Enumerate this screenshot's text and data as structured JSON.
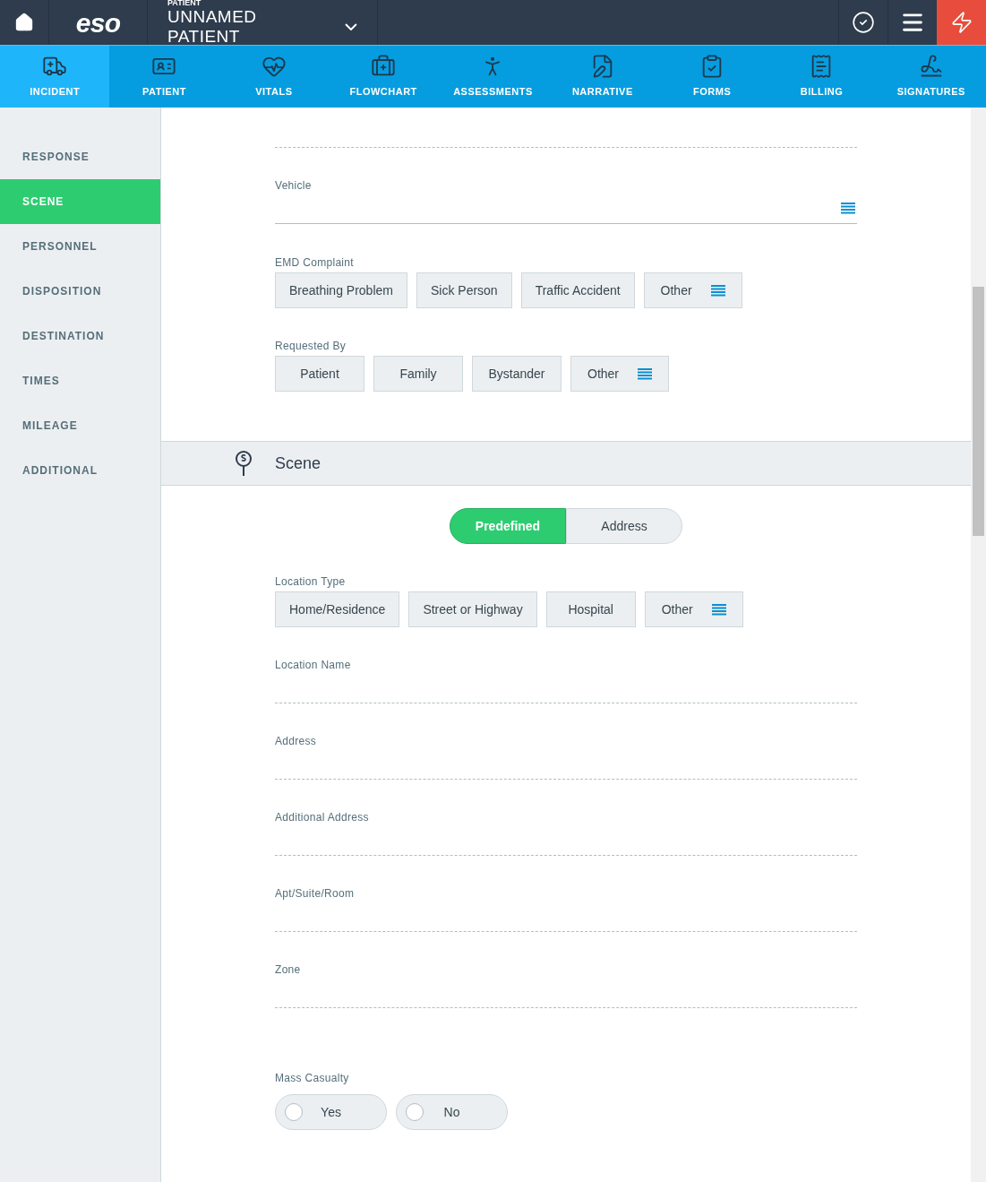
{
  "header": {
    "patient_label": "PATIENT",
    "patient_name": "UNNAMED PATIENT",
    "logo": "eso"
  },
  "nav_tabs": [
    {
      "label": "INCIDENT",
      "selected": true
    },
    {
      "label": "PATIENT",
      "selected": false
    },
    {
      "label": "VITALS",
      "selected": false
    },
    {
      "label": "FLOWCHART",
      "selected": false
    },
    {
      "label": "ASSESSMENTS",
      "selected": false
    },
    {
      "label": "NARRATIVE",
      "selected": false
    },
    {
      "label": "FORMS",
      "selected": false
    },
    {
      "label": "BILLING",
      "selected": false
    },
    {
      "label": "SIGNATURES",
      "selected": false
    }
  ],
  "sidebar": {
    "items": [
      {
        "label": "RESPONSE",
        "selected": false
      },
      {
        "label": "SCENE",
        "selected": true
      },
      {
        "label": "PERSONNEL",
        "selected": false
      },
      {
        "label": "DISPOSITION",
        "selected": false
      },
      {
        "label": "DESTINATION",
        "selected": false
      },
      {
        "label": "TIMES",
        "selected": false
      },
      {
        "label": "MILEAGE",
        "selected": false
      },
      {
        "label": "ADDITIONAL",
        "selected": false
      }
    ]
  },
  "response_fields": [
    {
      "kind": "select",
      "label": "Vehicle"
    },
    {
      "kind": "choices",
      "label": "EMD Complaint",
      "options": [
        {
          "label": "Breathing Problem",
          "selected": false
        },
        {
          "label": "Sick Person",
          "selected": false
        },
        {
          "label": "Traffic Accident",
          "selected": false
        }
      ],
      "other": "Other"
    },
    {
      "kind": "choices",
      "label": "Requested By",
      "options": [
        {
          "label": "Patient",
          "selected": false
        },
        {
          "label": "Family",
          "selected": false
        },
        {
          "label": "Bystander",
          "selected": false
        }
      ],
      "other": "Other"
    }
  ],
  "scene_section": {
    "title": "Scene",
    "toggle": [
      {
        "label": "Predefined",
        "selected": true
      },
      {
        "label": "Address",
        "selected": false
      }
    ],
    "fields": [
      {
        "kind": "choices",
        "label": "Location Type",
        "options": [
          {
            "label": "Home/Residence",
            "selected": false
          },
          {
            "label": "Street or Highway",
            "selected": false
          },
          {
            "label": "Hospital",
            "selected": false
          }
        ],
        "other": "Other"
      },
      {
        "kind": "text",
        "label": "Location Name"
      },
      {
        "kind": "text",
        "label": "Address"
      },
      {
        "kind": "text",
        "label": "Additional Address"
      },
      {
        "kind": "text",
        "label": "Apt/Suite/Room"
      },
      {
        "kind": "text",
        "label": "Zone"
      },
      {
        "kind": "radio",
        "label": "Mass Casualty",
        "options": [
          {
            "label": "Yes",
            "selected": false
          },
          {
            "label": "No",
            "selected": false
          }
        ]
      }
    ]
  }
}
